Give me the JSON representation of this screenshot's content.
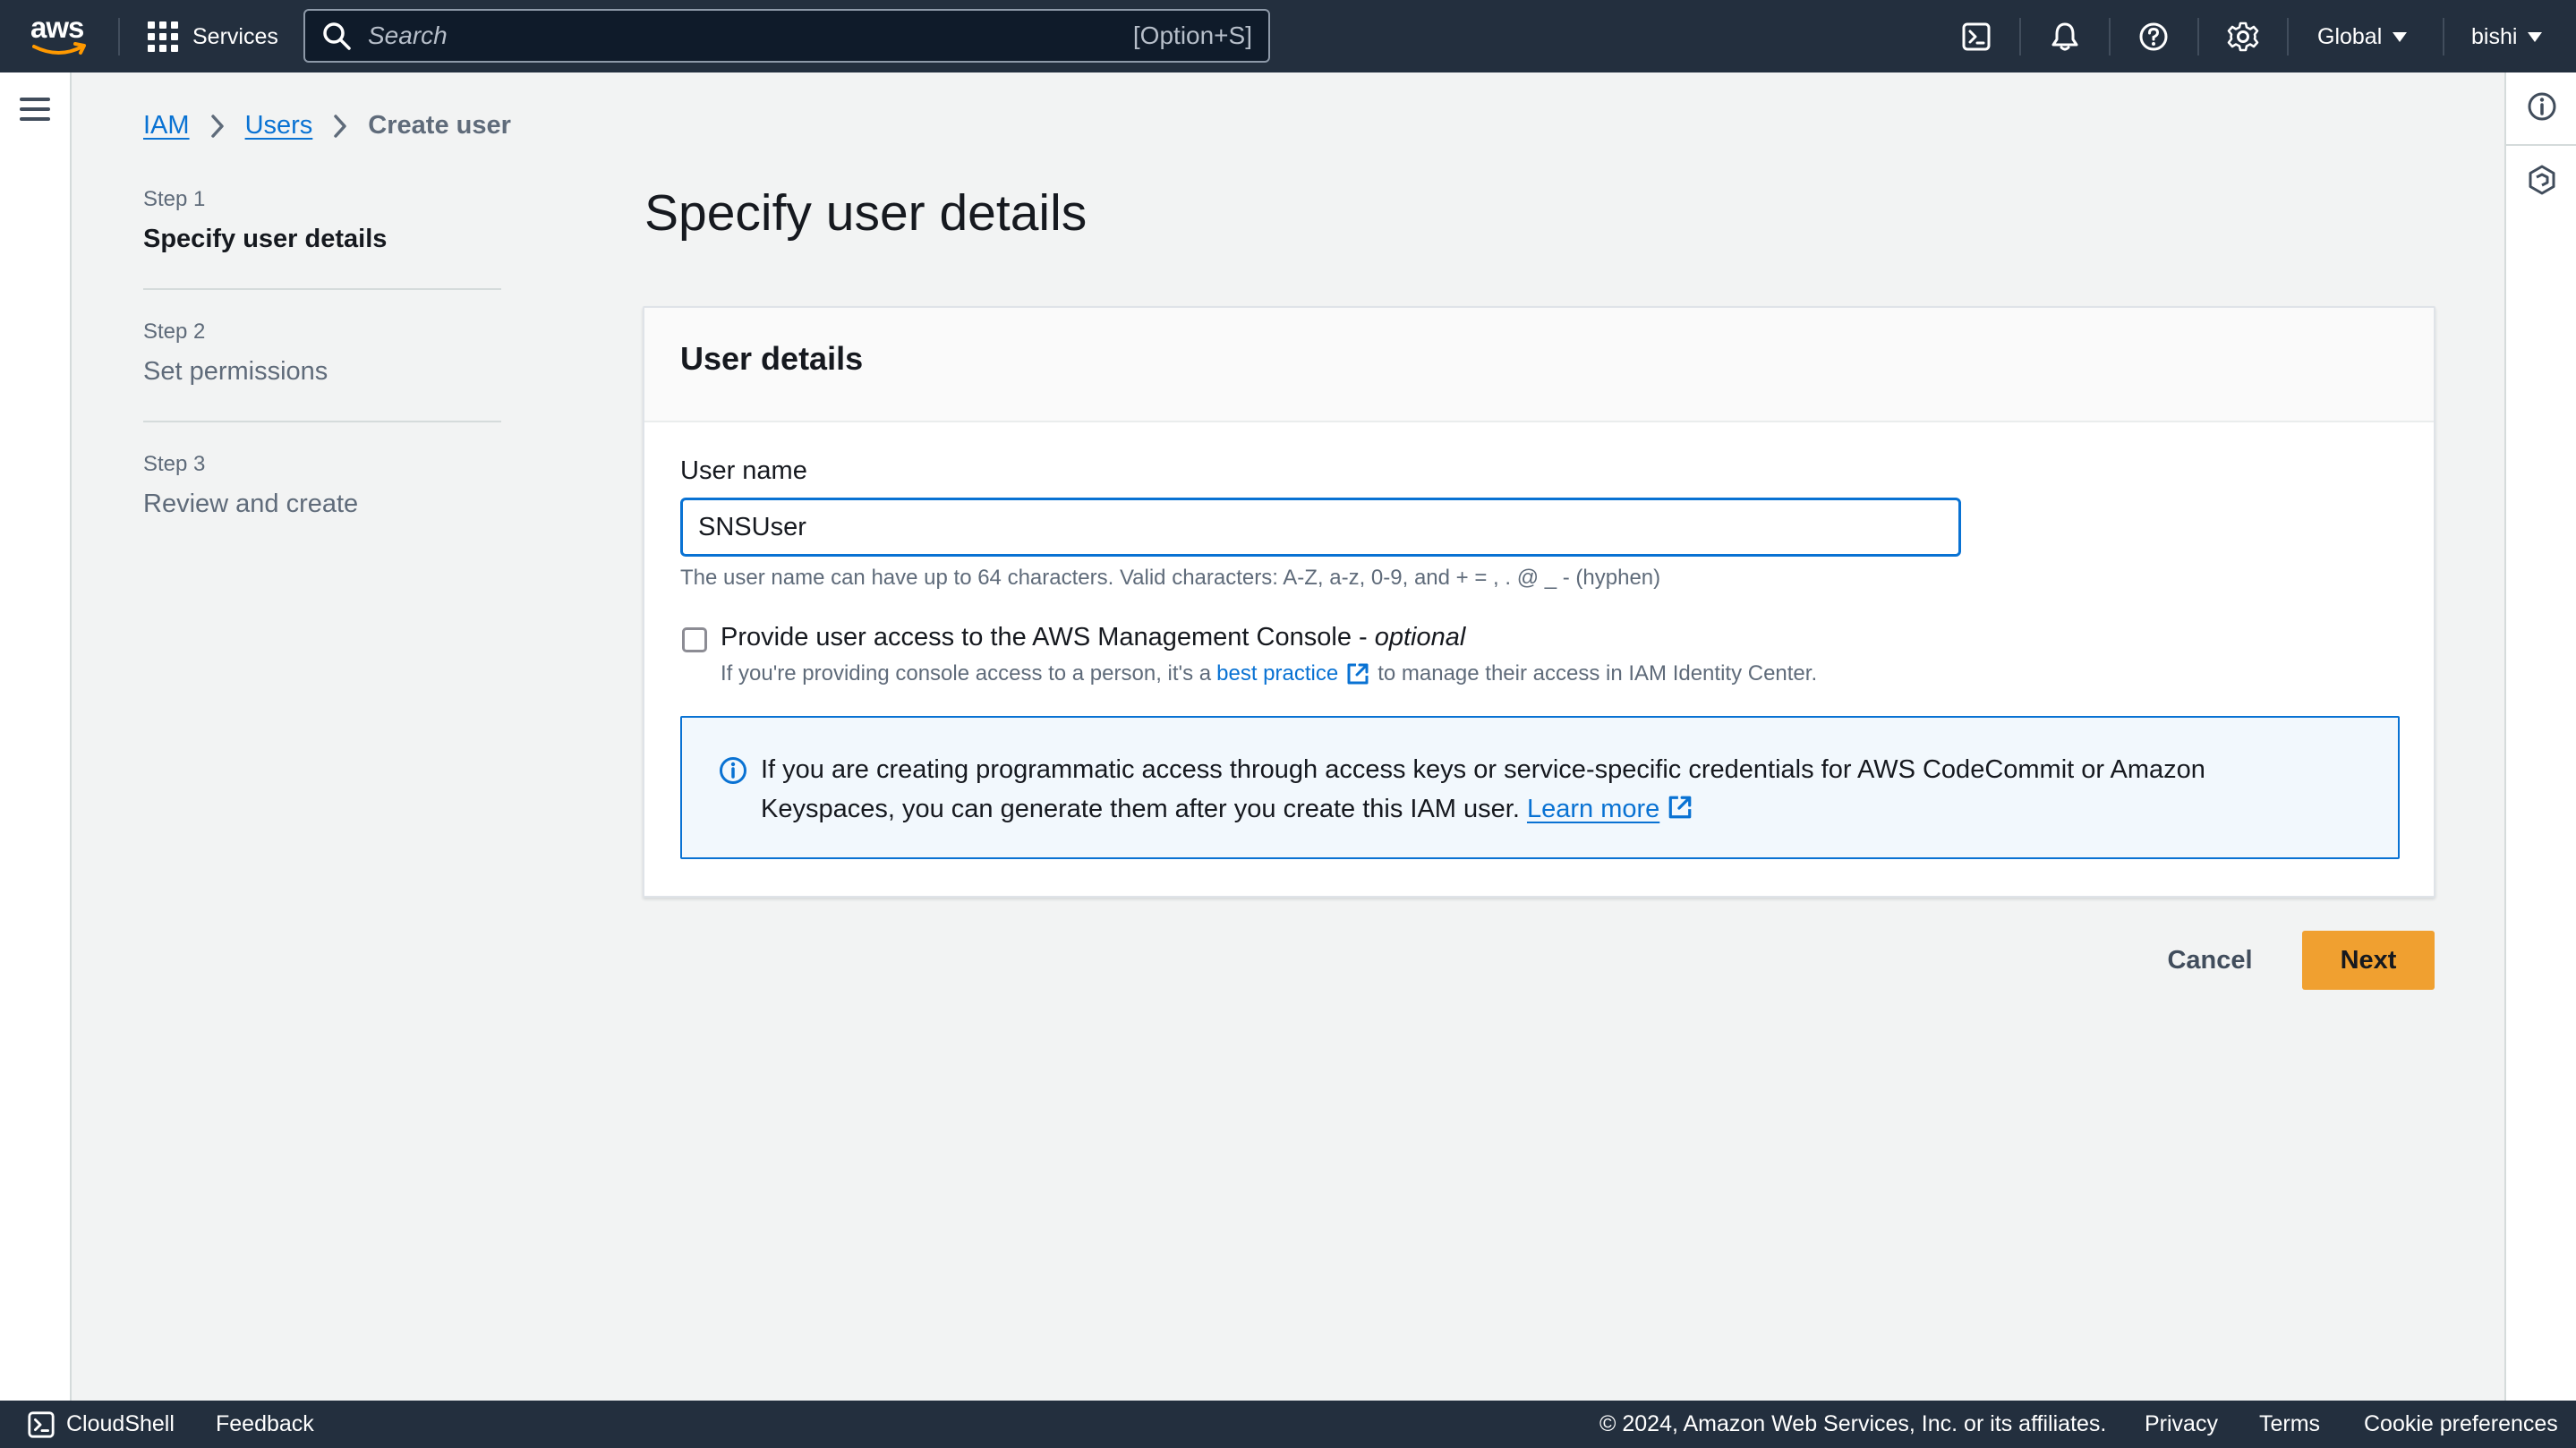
{
  "topnav": {
    "logo_text": "aws",
    "services_label": "Services",
    "search_placeholder": "Search",
    "search_shortcut": "[Option+S]",
    "region_label": "Global",
    "user_label": "bishi"
  },
  "breadcrumb": {
    "items": [
      "IAM",
      "Users"
    ],
    "current": "Create user"
  },
  "steps": [
    {
      "number": "Step 1",
      "title": "Specify user details",
      "active": true
    },
    {
      "number": "Step 2",
      "title": "Set permissions",
      "active": false
    },
    {
      "number": "Step 3",
      "title": "Review and create",
      "active": false
    }
  ],
  "page": {
    "title": "Specify user details"
  },
  "panel": {
    "header": "User details",
    "username_label": "User name",
    "username_value": "SNSUser",
    "username_constraint": "The user name can have up to 64 characters. Valid characters: A-Z, a-z, 0-9, and + = , . @ _ - (hyphen)",
    "console_access_label": "Provide user access to the AWS Management Console - ",
    "console_access_optional": "optional",
    "console_access_checked": false,
    "console_desc_prefix": "If you're providing console access to a person, it's a",
    "console_desc_link": "best practice",
    "console_desc_suffix": "to manage their access in IAM Identity Center.",
    "info_text": "If you are creating programmatic access through access keys or service-specific credentials for AWS CodeCommit or Amazon Keyspaces, you can generate them after you create this IAM user.",
    "info_link": "Learn more"
  },
  "actions": {
    "cancel": "Cancel",
    "next": "Next"
  },
  "footer": {
    "cloudshell": "CloudShell",
    "feedback": "Feedback",
    "copyright": "© 2024, Amazon Web Services, Inc. or its affiliates.",
    "privacy": "Privacy",
    "terms": "Terms",
    "cookie_prefs": "Cookie preferences"
  },
  "colors": {
    "nav_bg": "#232f3e",
    "link": "#0972d3",
    "primary_button": "#f0a030",
    "page_bg": "#f2f3f3"
  },
  "icons": [
    "search-icon",
    "cloudshell-icon",
    "bell-icon",
    "help-icon",
    "settings-icon",
    "info-icon",
    "external-link-icon",
    "hamburger-icon",
    "grid-icon"
  ]
}
